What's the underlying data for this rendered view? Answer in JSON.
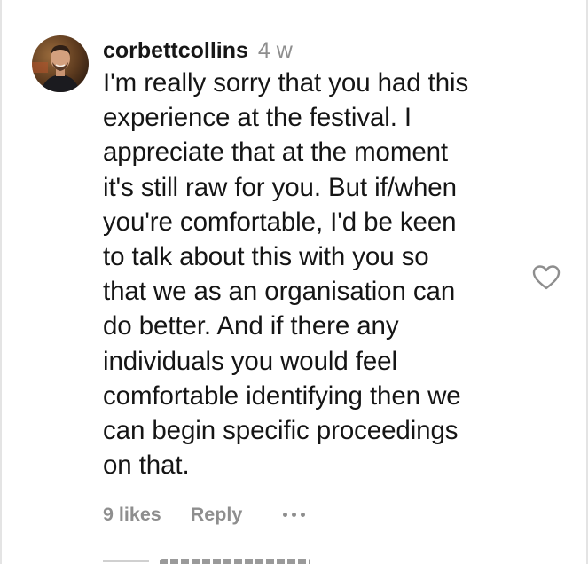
{
  "comment": {
    "username": "corbettcollins",
    "time_ago": "4 w",
    "text": "I'm really sorry that you had this\nexperience at the festival. I\nappreciate that at the moment\nit's still raw for you. But if/when\nyou're comfortable, I'd be keen\nto talk about this with you so\nthat we as an organisation can\ndo better. And if there any\nindividuals you would feel\ncomfortable identifying then we\ncan begin specific proceedings\non that.",
    "likes_label": "9 likes",
    "reply_label": "Reply",
    "avatar_icon": "user-avatar-photo",
    "like_icon": "heart-outline-icon",
    "more_icon": "more-horizontal-icon"
  },
  "colors": {
    "text_primary": "#151515",
    "text_secondary": "#8e8e8e",
    "border": "#e4e4e4"
  }
}
